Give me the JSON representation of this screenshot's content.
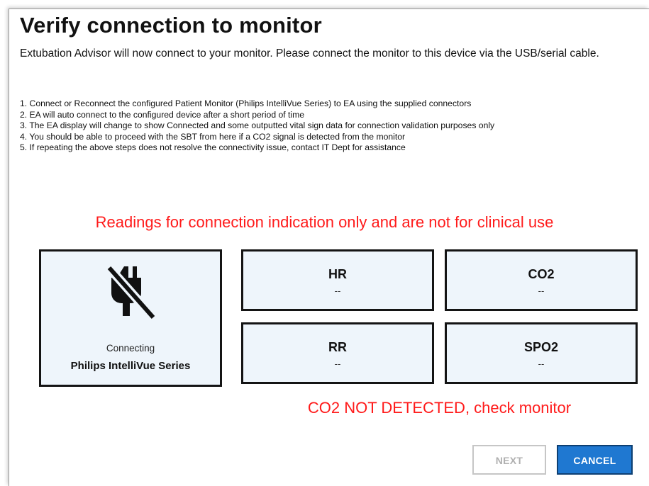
{
  "dialog": {
    "title": "Verify connection to monitor",
    "intro": "Extubation Advisor will now connect to your monitor.  Please connect the monitor to this device via the USB/serial cable.",
    "steps": [
      "1. Connect or Reconnect the configured Patient Monitor (Philips IntelliVue Series) to EA using the supplied connectors",
      "2. EA will auto connect to the configured device after a short period of time",
      "3. The EA display will change to show Connected and some outputted vital sign data for connection validation purposes only",
      "4. You should be able to proceed with the SBT from here if a CO2 signal is detected from the monitor",
      "5. If repeating the above steps does not resolve the connectivity issue, contact IT Dept for assistance"
    ],
    "warning": "Readings for connection indication only and are not for clinical use",
    "monitor": {
      "icon": "power-plug-off-icon",
      "status": "Connecting",
      "device": "Philips IntelliVue Series"
    },
    "vitals": {
      "hr": {
        "label": "HR",
        "value": "--"
      },
      "co2": {
        "label": "CO2",
        "value": "--"
      },
      "rr": {
        "label": "RR",
        "value": "--"
      },
      "spo2": {
        "label": "SPO2",
        "value": "--"
      }
    },
    "co2_alert": "CO2 NOT DETECTED, check monitor",
    "buttons": {
      "next": "NEXT",
      "cancel": "CANCEL"
    },
    "colors": {
      "alert_red": "#ff1a1a",
      "tile_bg": "#eef5fb",
      "cancel_bg": "#1f78d1",
      "disabled_text": "#b0b0b0"
    }
  }
}
